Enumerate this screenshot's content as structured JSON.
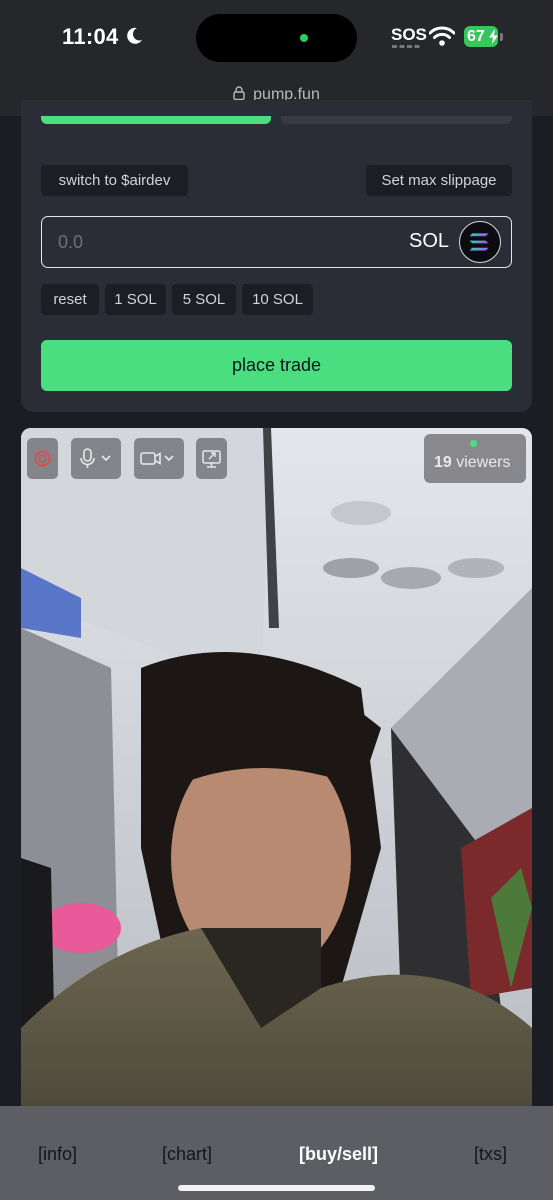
{
  "status_bar": {
    "time": "11:04",
    "sos": "SOS",
    "battery": "67",
    "url": "pump.fun",
    "icons": [
      "moon-icon",
      "wifi-icon",
      "battery-icon",
      "lock-icon"
    ]
  },
  "trade": {
    "switch_label": "switch to $airdev",
    "slippage_label": "Set max slippage",
    "amount_placeholder": "0.0",
    "amount_unit": "SOL",
    "quick_amounts": [
      "reset",
      "1 SOL",
      "5 SOL",
      "10 SOL"
    ],
    "place_trade_label": "place trade",
    "accent_color": "#4ade80"
  },
  "stream": {
    "viewer_count": "19",
    "viewer_label": " viewers",
    "controls": [
      "stop-icon",
      "microphone-icon",
      "camera-icon",
      "screen-share-icon"
    ]
  },
  "bottom_nav": {
    "items": [
      "[info]",
      "[chart]",
      "[buy/sell]",
      "[txs]"
    ],
    "active": "[buy/sell]"
  }
}
